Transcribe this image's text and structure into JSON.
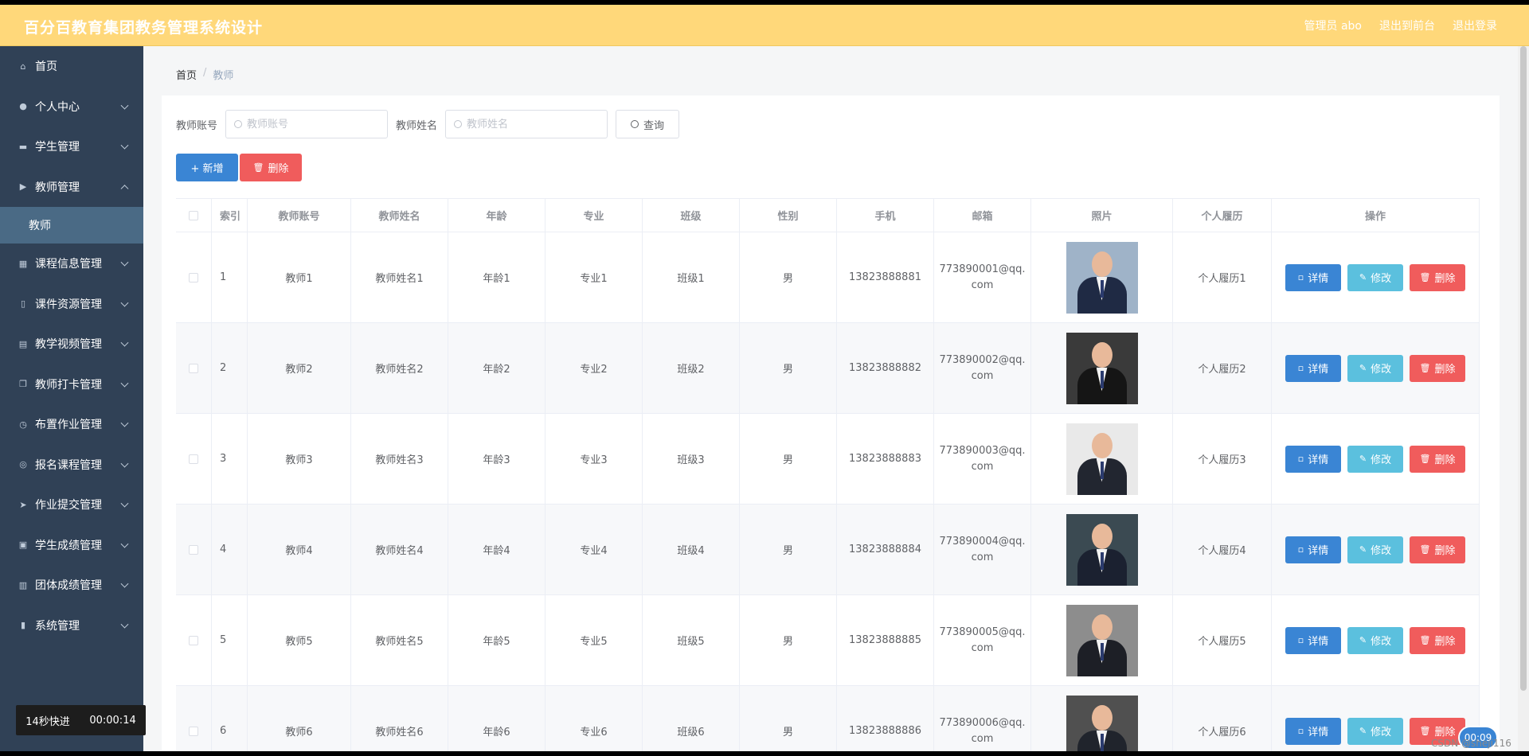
{
  "header": {
    "title": "百分百教育集团教务管理系统设计",
    "nav": [
      "管理员 abo",
      "退出到前台",
      "退出登录"
    ]
  },
  "sidebar": {
    "items": [
      {
        "label": "首页",
        "icon": "home-icon",
        "expandable": false
      },
      {
        "label": "个人中心",
        "icon": "user-icon",
        "expandable": true
      },
      {
        "label": "学生管理",
        "icon": "briefcase-icon",
        "expandable": true
      },
      {
        "label": "教师管理",
        "icon": "camera-icon",
        "expandable": true,
        "expanded": true,
        "children": [
          "教师"
        ]
      },
      {
        "label": "课程信息管理",
        "icon": "grid-icon",
        "expandable": true
      },
      {
        "label": "课件资源管理",
        "icon": "mic-icon",
        "expandable": true
      },
      {
        "label": "教学视频管理",
        "icon": "video-icon",
        "expandable": true
      },
      {
        "label": "教师打卡管理",
        "icon": "copy-icon",
        "expandable": true
      },
      {
        "label": "布置作业管理",
        "icon": "clock-icon",
        "expandable": true
      },
      {
        "label": "报名课程管理",
        "icon": "circle-icon",
        "expandable": true
      },
      {
        "label": "作业提交管理",
        "icon": "send-icon",
        "expandable": true
      },
      {
        "label": "学生成绩管理",
        "icon": "clipboard-icon",
        "expandable": true
      },
      {
        "label": "团体成绩管理",
        "icon": "document-icon",
        "expandable": true
      },
      {
        "label": "系统管理",
        "icon": "chart-icon",
        "expandable": true
      }
    ]
  },
  "overlay": {
    "label": "14秒快进",
    "time": "00:00:14"
  },
  "breadcrumb": {
    "home": "首页",
    "separator": "/",
    "current": "教师"
  },
  "search": {
    "account_label": "教师账号",
    "account_placeholder": "教师账号",
    "name_label": "教师姓名",
    "name_placeholder": "教师姓名",
    "query_label": "查询"
  },
  "actions": {
    "add_label": "+ 新增",
    "delete_label": "删除"
  },
  "table": {
    "headers": [
      "",
      "索引",
      "教师账号",
      "教师姓名",
      "年龄",
      "专业",
      "班级",
      "性别",
      "手机",
      "邮箱",
      "照片",
      "个人履历",
      "操作"
    ],
    "rows": [
      {
        "index": "1",
        "account": "教师1",
        "name": "教师姓名1",
        "age": "年龄1",
        "major": "专业1",
        "class": "班级1",
        "gender": "男",
        "phone": "13823888881",
        "email_1": "773890001@qq.",
        "email_2": "com",
        "resume": "个人履历1"
      },
      {
        "index": "2",
        "account": "教师2",
        "name": "教师姓名2",
        "age": "年龄2",
        "major": "专业2",
        "class": "班级2",
        "gender": "男",
        "phone": "13823888882",
        "email_1": "773890002@qq.",
        "email_2": "com",
        "resume": "个人履历2"
      },
      {
        "index": "3",
        "account": "教师3",
        "name": "教师姓名3",
        "age": "年龄3",
        "major": "专业3",
        "class": "班级3",
        "gender": "男",
        "phone": "13823888883",
        "email_1": "773890003@qq.",
        "email_2": "com",
        "resume": "个人履历3"
      },
      {
        "index": "4",
        "account": "教师4",
        "name": "教师姓名4",
        "age": "年龄4",
        "major": "专业4",
        "class": "班级4",
        "gender": "男",
        "phone": "13823888884",
        "email_1": "773890004@qq.",
        "email_2": "com",
        "resume": "个人履历4"
      },
      {
        "index": "5",
        "account": "教师5",
        "name": "教师姓名5",
        "age": "年龄5",
        "major": "专业5",
        "class": "班级5",
        "gender": "男",
        "phone": "13823888885",
        "email_1": "773890005@qq.",
        "email_2": "com",
        "resume": "个人履历5"
      },
      {
        "index": "6",
        "account": "教师6",
        "name": "教师姓名6",
        "age": "年龄6",
        "major": "专业6",
        "class": "班级6",
        "gender": "男",
        "phone": "13823888886",
        "email_1": "773890006@qq.",
        "email_2": "com",
        "resume": "个人履历6"
      }
    ],
    "op_labels": {
      "detail": "详情",
      "edit": "修改",
      "delete": "删除"
    }
  },
  "timer_badge": "00:09",
  "watermark": "CSDN @sheji116",
  "colors": {
    "header": "#ffd87a",
    "sidebar": "#304156",
    "primary": "#3a85d4",
    "info": "#5bc0de",
    "danger": "#f05c5c"
  }
}
